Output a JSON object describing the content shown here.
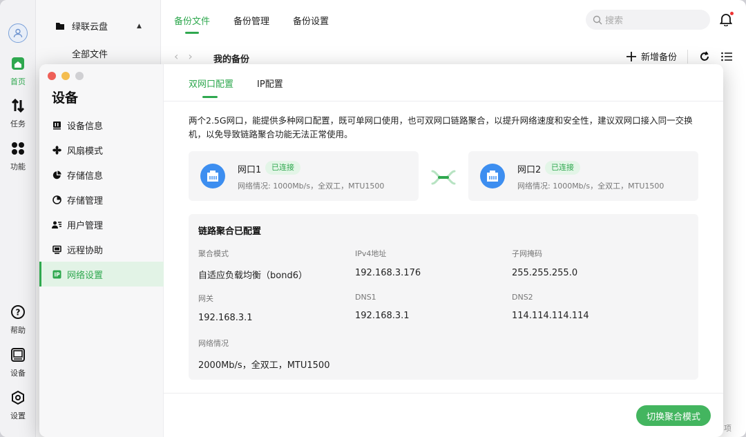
{
  "app": {
    "rail": {
      "home_label": "首页",
      "tasks_label": "任务",
      "features_label": "功能",
      "help_label": "帮助",
      "device_label": "设备",
      "settings_label": "设置"
    },
    "sidebar": {
      "cloud_label": "绿联云盘",
      "all_files_label": "全部文件"
    },
    "tabs": [
      "备份文件",
      "备份管理",
      "备份设置"
    ],
    "search_placeholder": "搜索",
    "breadcrumb": "我的备份",
    "add_backup_label": "新增备份",
    "corner_text": "项"
  },
  "dialog": {
    "title": "设备",
    "menu": [
      {
        "label": "设备信息",
        "icon": "device-info-icon"
      },
      {
        "label": "风扇模式",
        "icon": "fan-icon"
      },
      {
        "label": "存储信息",
        "icon": "pie-chart-icon"
      },
      {
        "label": "存储管理",
        "icon": "storage-manage-icon"
      },
      {
        "label": "用户管理",
        "icon": "users-icon"
      },
      {
        "label": "远程协助",
        "icon": "monitor-icon"
      },
      {
        "label": "网络设置",
        "icon": "ip-icon",
        "active": true
      }
    ],
    "tabs": [
      "双网口配置",
      "IP配置"
    ],
    "description": "两个2.5G网口，能提供多种网口配置，既可单网口使用，也可双网口链路聚合，以提升网络速度和安全性，建议双网口接入同一交换机，以免导致链路聚合功能无法正常使用。",
    "ports": [
      {
        "name": "网口1",
        "status": "已连接",
        "info": "网络情况: 1000Mb/s，全双工，MTU1500"
      },
      {
        "name": "网口2",
        "status": "已连接",
        "info": "网络情况: 1000Mb/s，全双工，MTU1500"
      }
    ],
    "aggregation": {
      "title": "链路聚合已配置",
      "fields": [
        {
          "key": "聚合模式",
          "value": "自适应负载均衡（bond6）"
        },
        {
          "key": "IPv4地址",
          "value": "192.168.3.176"
        },
        {
          "key": "子网掩码",
          "value": "255.255.255.0"
        },
        {
          "key": "网关",
          "value": "192.168.3.1"
        },
        {
          "key": "DNS1",
          "value": "192.168.3.1"
        },
        {
          "key": "DNS2",
          "value": "114.114.114.114"
        },
        {
          "key": "网络情况",
          "value": "2000Mb/s，全双工，MTU1500"
        }
      ]
    },
    "switch_button_label": "切换聚合模式"
  },
  "colors": {
    "accent": "#2fa84f",
    "button": "#43b55f",
    "port_icon": "#3d8ef0",
    "close": "#ee5f57",
    "minimize": "#f4bd4f",
    "inactive": "#d0d0d3"
  }
}
